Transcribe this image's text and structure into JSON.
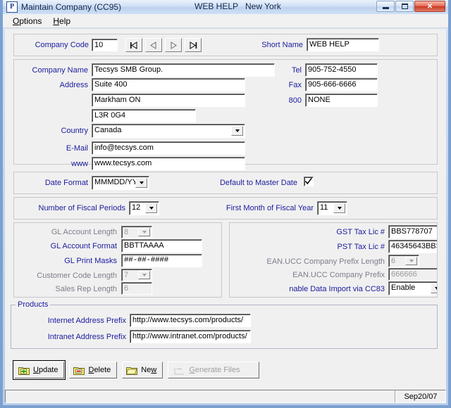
{
  "window": {
    "app_icon": "P",
    "title": "Maintain Company (CC95)",
    "title_help": "WEB HELP",
    "title_location": "New York",
    "minimize_label": "Minimize",
    "restore_label": "Restore",
    "close_label": "✕"
  },
  "menu": {
    "items": [
      {
        "label": "Options",
        "accel": "O"
      },
      {
        "label": "Help",
        "accel": "H"
      }
    ]
  },
  "header_panel": {
    "company_code_label": "Company Code",
    "company_code_value": "10",
    "short_name_label": "Short Name",
    "short_name_value": "WEB HELP",
    "nav": [
      {
        "name": "first-record-button",
        "glyph": "first"
      },
      {
        "name": "previous-record-button",
        "glyph": "prev"
      },
      {
        "name": "next-record-button",
        "glyph": "next"
      },
      {
        "name": "last-record-button",
        "glyph": "last"
      }
    ]
  },
  "address_panel": {
    "company_name_label": "Company Name",
    "company_name_value": "Tecsys SMB Group.",
    "address_label": "Address",
    "address_line1": "Suite 400",
    "address_line2": "Markham ON",
    "address_line3": "L3R 0G4",
    "country_label": "Country",
    "country_value": "Canada",
    "email_label": "E-Mail",
    "email_value": "info@tecsys.com",
    "www_label": "www",
    "www_value": "www.tecsys.com",
    "tel_label": "Tel",
    "tel_value": "905-752-4550",
    "fax_label": "Fax",
    "fax_value": "905-666-6666",
    "toll_free_label": "800",
    "toll_free_value": "NONE"
  },
  "date_panel": {
    "date_format_label": "Date Format",
    "date_format_value": "MMMDD/YY",
    "default_master_date_label": "Default to Master Date",
    "default_master_date_checked": true
  },
  "fiscal_panel": {
    "number_of_fiscal_periods_label": "Number of Fiscal Periods",
    "number_of_fiscal_periods_value": "12",
    "first_month_label": "First Month of Fiscal Year",
    "first_month_value": "11"
  },
  "gl_panel": {
    "gl_account_length_label": "GL Account Length",
    "gl_account_length_value": "8",
    "gl_account_format_label": "GL Account Format",
    "gl_account_format_value": "BBTTAAAA",
    "gl_print_masks_label": "GL Print Masks",
    "gl_print_masks_value": "##-##-####",
    "customer_code_length_label": "Customer Code Length",
    "customer_code_length_value": "7",
    "sales_rep_length_label": "Sales Rep Length",
    "sales_rep_length_value": "6"
  },
  "tax_panel": {
    "gst_label": "GST Tax Lic #",
    "gst_value": "BBS778707",
    "pst_label": "PST Tax Lic #",
    "pst_value": "46345643BBS",
    "ean_prefix_length_label": "EAN.UCC Company Prefix Length",
    "ean_prefix_length_value": "6",
    "ean_prefix_label": "EAN.UCC Company Prefix",
    "ean_prefix_value": "666666",
    "data_import_label": "nable Data Import via CC83",
    "data_import_value": "Enable"
  },
  "products_group": {
    "title": "Products",
    "internet_label": "Internet Address Prefix",
    "internet_value": "http://www.tecsys.com/products/",
    "intranet_label": "Intranet Address Prefix",
    "intranet_value": "http://www.intranet.com/products/"
  },
  "buttons": {
    "update": {
      "label": "Update",
      "accel": "U",
      "icon": "folder-plus-icon"
    },
    "delete": {
      "label": "Delete",
      "accel": "D",
      "icon": "folder-minus-icon"
    },
    "new": {
      "label": "New",
      "accel": "w",
      "icon": "folder-icon"
    },
    "generate": {
      "label": "Generate Files",
      "accel": "G",
      "icon": "folder-disabled-icon"
    }
  },
  "statusbar": {
    "message": "",
    "date": "Sep20/07"
  },
  "colors": {
    "label_blue": "#1b1b9e",
    "panel_grey": "#f0f0f0",
    "window_border": "#7ba0d0",
    "close_red": "#c93a23"
  }
}
